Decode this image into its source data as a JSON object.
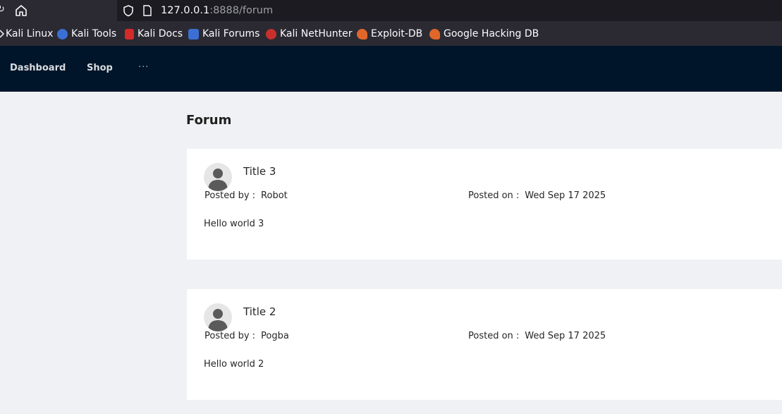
{
  "browser": {
    "url_host": "127.0.0.1",
    "url_rest": ":8888/forum"
  },
  "bookmarks": [
    {
      "label": "Kali Linux",
      "icon": "kali-icon"
    },
    {
      "label": "Kali Tools",
      "icon": "kali-tools-icon"
    },
    {
      "label": "Kali Docs",
      "icon": "kali-docs-icon"
    },
    {
      "label": "Kali Forums",
      "icon": "kali-forums-icon"
    },
    {
      "label": "Kali NetHunter",
      "icon": "nethunter-icon"
    },
    {
      "label": "Exploit-DB",
      "icon": "exploitdb-icon"
    },
    {
      "label": "Google Hacking DB",
      "icon": "ghdb-icon"
    }
  ],
  "nav": {
    "dashboard": "Dashboard",
    "shop": "Shop",
    "more": "···"
  },
  "page": {
    "title": "Forum"
  },
  "posts": [
    {
      "title": "Title 3",
      "posted_by_label": "Posted by :",
      "author": "Robot",
      "posted_on_label": "Posted on :",
      "date": "Wed Sep 17 2025",
      "body": "Hello world 3"
    },
    {
      "title": "Title 2",
      "posted_by_label": "Posted by :",
      "author": "Pogba",
      "posted_on_label": "Posted on :",
      "date": "Wed Sep 17 2025",
      "body": "Hello world 2"
    }
  ],
  "colors": {
    "nav_bg": "#001529",
    "browser_bg": "#2b2a33",
    "page_bg": "#f0f1f5"
  }
}
